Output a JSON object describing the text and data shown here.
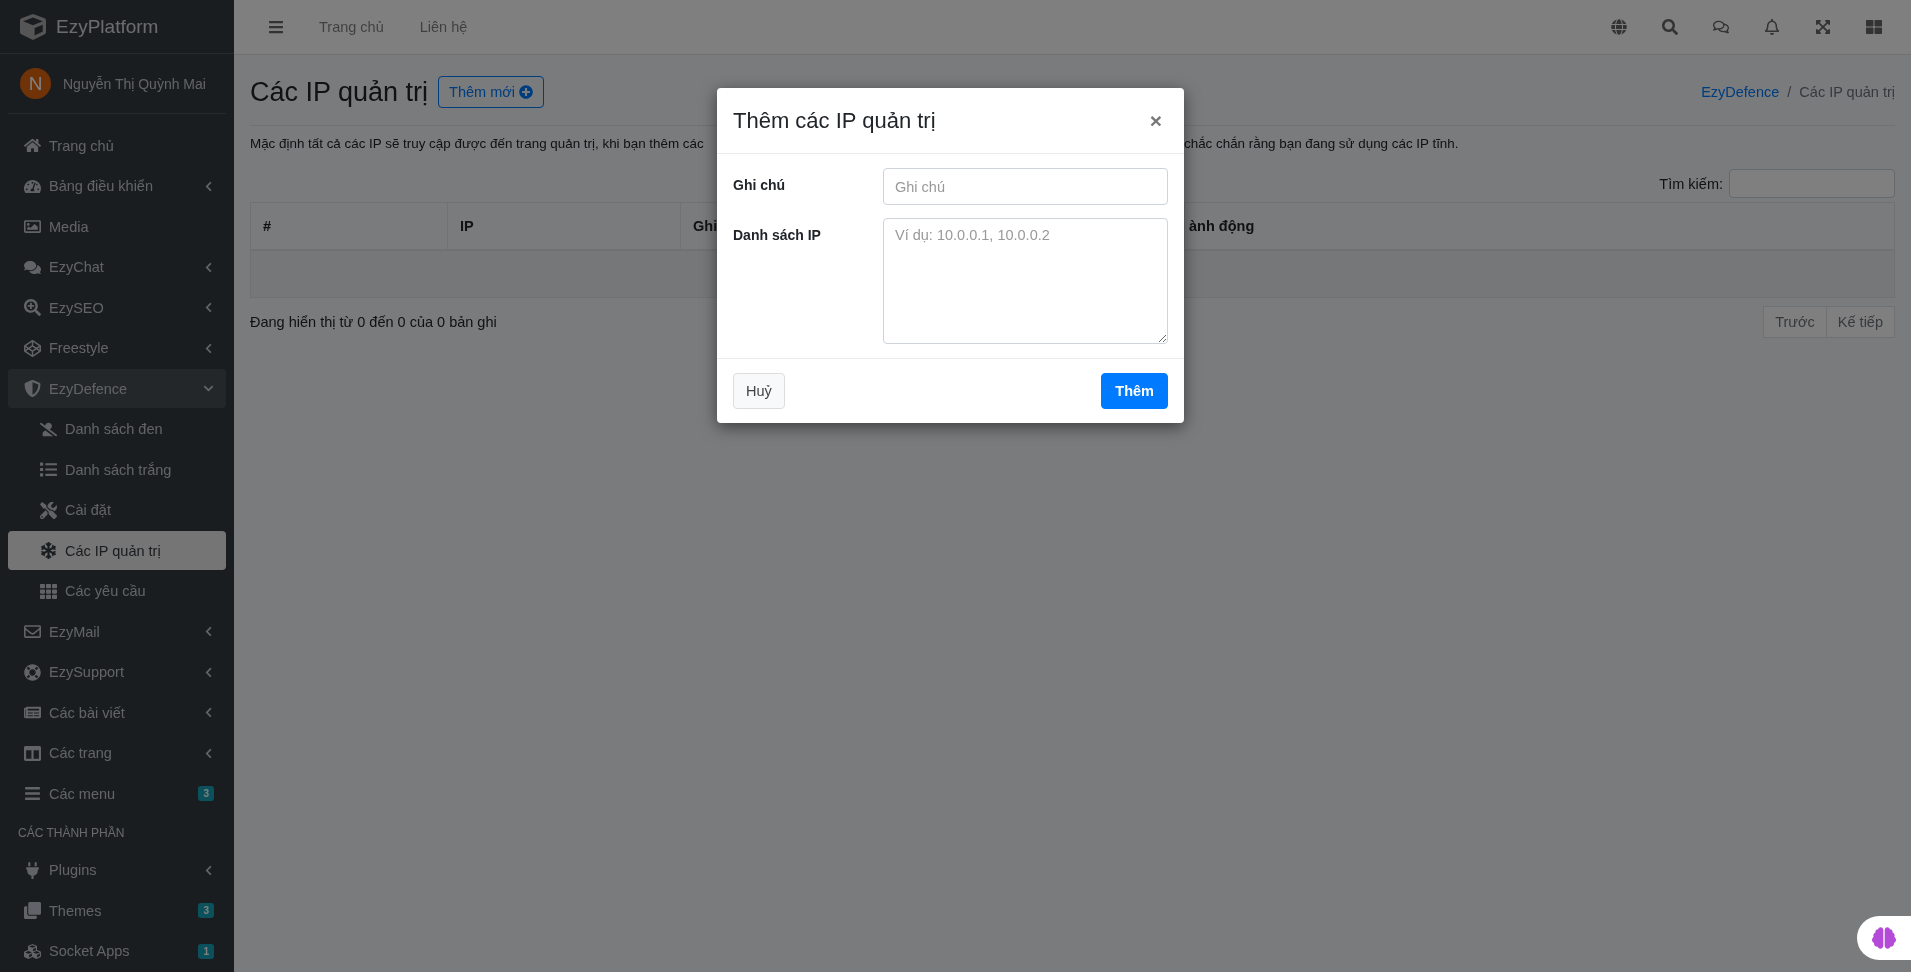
{
  "brand": {
    "name": "EzyPlatform"
  },
  "user": {
    "initial": "N",
    "name": "Nguyễn Thị Quỳnh Mai"
  },
  "sidebar": {
    "items": [
      {
        "kind": "link",
        "label": "Trang chủ",
        "selected": false
      },
      {
        "kind": "link",
        "label": "Bảng điều khiển",
        "selected": false,
        "expanded": false
      },
      {
        "kind": "link",
        "label": "Media",
        "selected": false
      },
      {
        "kind": "link",
        "label": "EzyChat",
        "selected": false,
        "expanded": false
      },
      {
        "kind": "link",
        "label": "EzySEO",
        "selected": false,
        "expanded": false
      },
      {
        "kind": "link",
        "label": "Freestyle",
        "selected": false,
        "expanded": false
      },
      {
        "kind": "link",
        "label": "EzyDefence",
        "selected": false,
        "expanded": true,
        "children": [
          {
            "label": "Danh sách đen",
            "selected": false
          },
          {
            "label": "Danh sách trắng",
            "selected": false
          },
          {
            "label": "Cài đặt",
            "selected": false
          },
          {
            "label": "Các IP quản trị",
            "selected": true
          },
          {
            "label": "Các yêu cầu",
            "selected": false
          }
        ]
      },
      {
        "kind": "link",
        "label": "EzyMail",
        "selected": false,
        "expanded": false
      },
      {
        "kind": "link",
        "label": "EzySupport",
        "selected": false,
        "expanded": false
      },
      {
        "kind": "link",
        "label": "Các bài viết",
        "selected": false,
        "expanded": false
      },
      {
        "kind": "link",
        "label": "Các trang",
        "selected": false,
        "expanded": false
      },
      {
        "kind": "link",
        "label": "Các menu",
        "selected": false,
        "badge": "3"
      },
      {
        "kind": "header",
        "label": "CÁC THÀNH PHẦN"
      },
      {
        "kind": "link",
        "label": "Plugins",
        "selected": false,
        "expanded": false
      },
      {
        "kind": "link",
        "label": "Themes",
        "selected": false,
        "badge": "3"
      },
      {
        "kind": "link",
        "label": "Socket Apps",
        "selected": false,
        "badge": "1"
      }
    ]
  },
  "topbar": {
    "links": [
      "Trang chủ",
      "Liên hệ"
    ]
  },
  "page": {
    "title": "Các IP quản trị",
    "add_button": "Thêm mới",
    "breadcrumb": [
      "EzyDefence",
      "/",
      "Các IP quản trị"
    ],
    "description_parts": [
      "Mặc định tất cả các IP sẽ truy cập được đến trang quản trị, khi bạn thêm các",
      "chắc chắn rằng bạn đang sử dụng các IP tĩnh."
    ],
    "search_label": "Tìm kiếm:",
    "table": {
      "columns": [
        "#",
        "IP",
        "Ghi",
        "ành động"
      ]
    },
    "info": "Đang hiển thị từ 0 đến 0 của 0 bản ghi",
    "pagination": [
      "Trước",
      "Kế tiếp"
    ]
  },
  "modal": {
    "title": "Thêm các IP quản trị",
    "close": "×",
    "fields": [
      {
        "kind": "input",
        "label": "Ghi chú",
        "placeholder": "Ghi chú"
      },
      {
        "kind": "textarea",
        "label": "Danh sách IP",
        "placeholder": "Ví dụ: 10.0.0.1, 10.0.0.2"
      }
    ],
    "cancel": "Huỷ",
    "submit": "Thêm"
  }
}
